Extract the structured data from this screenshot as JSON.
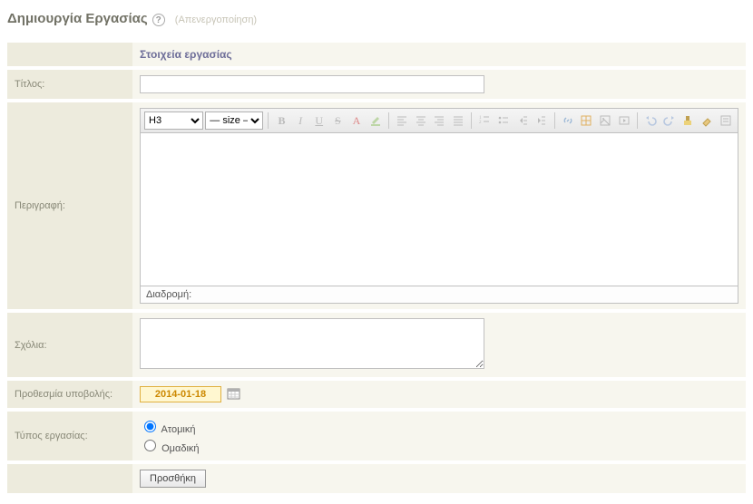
{
  "header": {
    "title": "Δημιουργία Εργασίας",
    "deactivate_label": "(Απενεργοποίηση)"
  },
  "section_heading": "Στοιχεία εργασίας",
  "labels": {
    "title": "Τίτλος:",
    "description": "Περιγραφή:",
    "comments": "Σχόλια:",
    "deadline": "Προθεσμία υποβολής:",
    "work_type": "Τύπος εργασίας:"
  },
  "fields": {
    "title_value": "",
    "comments_value": "",
    "deadline_value": "2014-01-18"
  },
  "editor": {
    "block_format": "H3",
    "size_option": "— size —",
    "path_label": "Διαδρομή:"
  },
  "work_type_options": {
    "individual": "Ατομική",
    "group": "Ομαδική",
    "selected": "individual"
  },
  "buttons": {
    "submit": "Προσθήκη"
  }
}
